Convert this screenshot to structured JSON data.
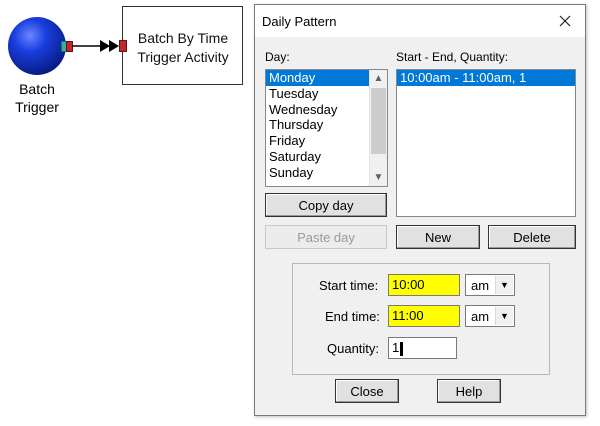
{
  "diagram": {
    "source_node_label": "Batch\nTrigger",
    "activity_label": "Batch By Time\nTrigger Activity"
  },
  "dialog": {
    "title": "Daily Pattern",
    "day_label": "Day:",
    "days": [
      "Monday",
      "Tuesday",
      "Wednesday",
      "Thursday",
      "Friday",
      "Saturday",
      "Sunday"
    ],
    "selected_day": "Monday",
    "schedule_label": "Start - End, Quantity:",
    "schedule_entries": [
      "10:00am - 11:00am, 1"
    ],
    "buttons": {
      "copy_day": "Copy day",
      "paste_day": "Paste day",
      "new": "New",
      "delete": "Delete",
      "close": "Close",
      "help": "Help"
    },
    "start_time": {
      "label": "Start time:",
      "value": "10:00",
      "ampm": "am"
    },
    "end_time": {
      "label": "End time:",
      "value": "11:00",
      "ampm": "am"
    },
    "quantity": {
      "label": "Quantity:",
      "value": "1"
    }
  },
  "colors": {
    "selection": "#0078d7",
    "field_highlight": "#ffff00",
    "node_blue": "#1a3fe0",
    "port_red": "#c0262d",
    "port_teal": "#2bb3a3"
  }
}
